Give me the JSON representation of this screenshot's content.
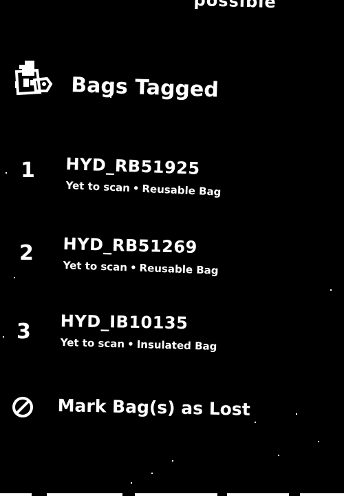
{
  "top_fragment": "possible",
  "section": {
    "title": "Bags Tagged",
    "icon": "bag-tag-icon"
  },
  "items": [
    {
      "number": "1",
      "id": "HYD_RB51925",
      "status": "Yet to scan",
      "separator": "•",
      "type": "Reusable Bag"
    },
    {
      "number": "2",
      "id": "HYD_RB51269",
      "status": "Yet to scan",
      "separator": "•",
      "type": "Reusable Bag"
    },
    {
      "number": "3",
      "id": "HYD_IB10135",
      "status": "Yet to scan",
      "separator": "•",
      "type": "Insulated Bag"
    }
  ],
  "lost_action": {
    "label": "Mark Bag(s) as Lost",
    "icon": "prohibited-icon"
  },
  "colors": {
    "background": "#000000",
    "foreground": "#ffffff"
  }
}
